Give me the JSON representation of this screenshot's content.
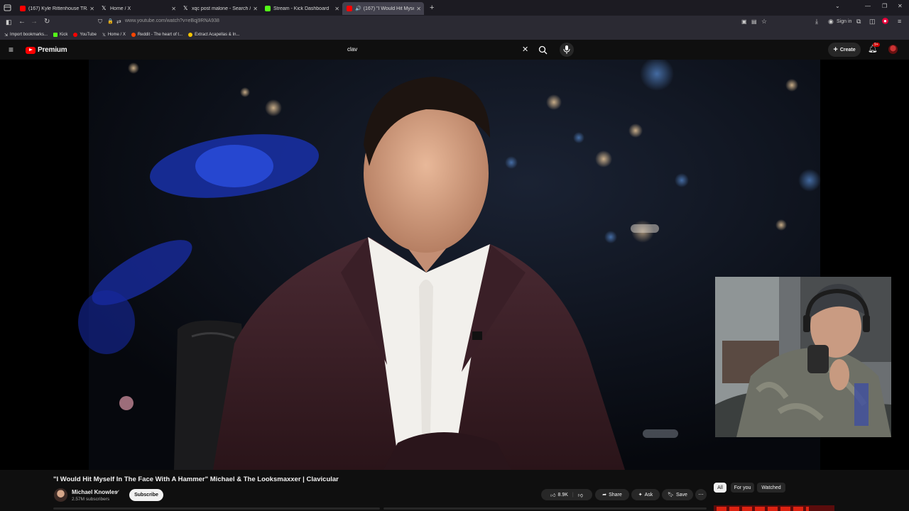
{
  "browser": {
    "tabs": [
      {
        "title": "(167) Kyle Rittenhouse TRASHE",
        "color": "#ff0000"
      },
      {
        "title": "Home / X",
        "color": "#ffffff"
      },
      {
        "title": "xqc post malone - Search / X",
        "color": "#ffffff"
      },
      {
        "title": "Stream - Kick Dashboard",
        "color": "#53fc18"
      },
      {
        "title": "(167) \"I Would Hit Myself I",
        "color": "#ff0000"
      }
    ],
    "url": "www.youtube.com/watch?v=eBqj9RNA938",
    "sign_in": "Sign in",
    "bookmarks": [
      "Import bookmarks...",
      "Kick",
      "YouTube",
      "Home / X",
      "Reddit - The heart of t...",
      "Extract Acapellas & In..."
    ]
  },
  "youtube": {
    "logo_text": "Premium",
    "search_value": "clav",
    "create_label": "Create",
    "notif_badge": "9+"
  },
  "video": {
    "title": "\"I Would Hit Myself In The Face With A Hammer\" Michael & The Looksmaxxer | Clavicular",
    "channel": "Michael Knowles",
    "subscribers": "2.57M subscribers",
    "subscribe_label": "Subscribe",
    "likes": "8.9K",
    "share_label": "Share",
    "ask_label": "Ask",
    "save_label": "Save"
  },
  "chips": [
    "All",
    "For you",
    "Watched"
  ]
}
